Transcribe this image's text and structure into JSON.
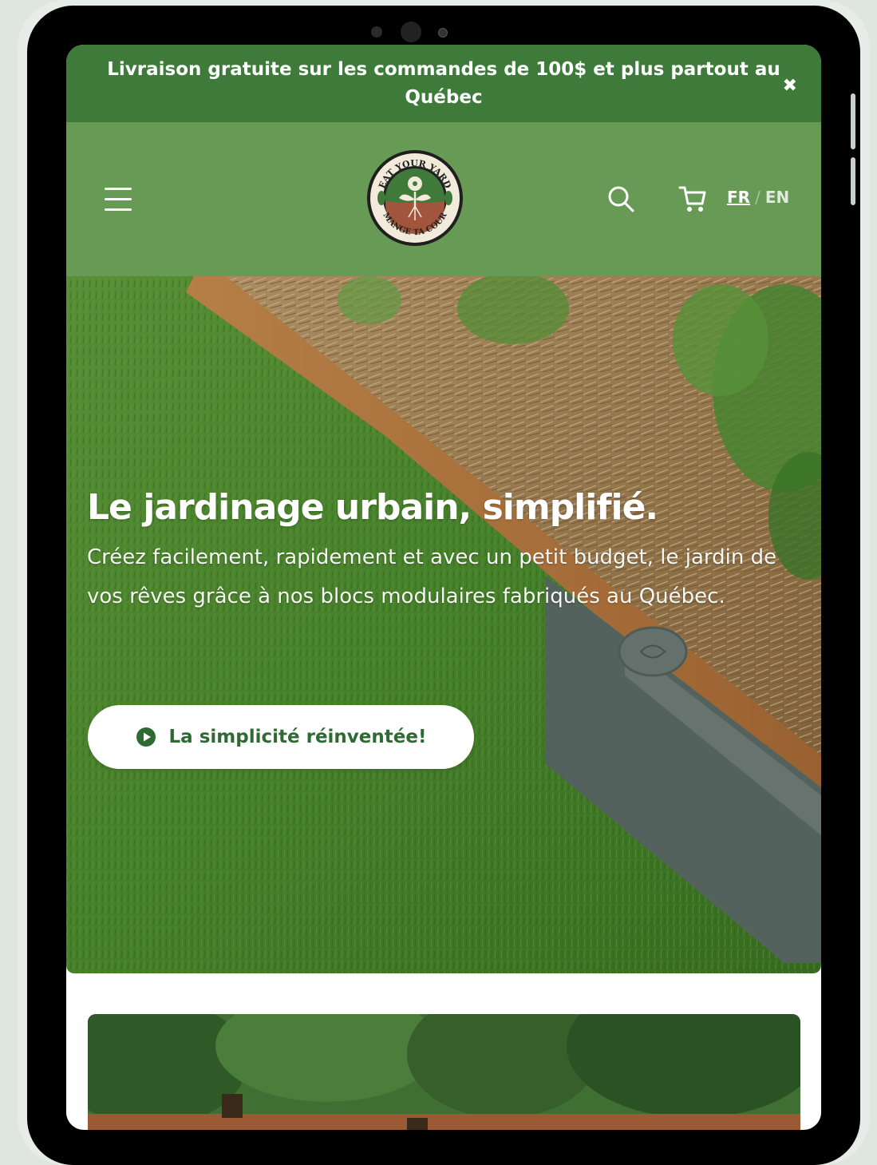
{
  "announcement": {
    "text": "Livraison gratuite sur les commandes de 100$ et plus partout au Québec",
    "close_icon": "close-icon"
  },
  "header": {
    "menu_icon": "hamburger-menu-icon",
    "logo": {
      "top_text": "EAT YOUR YARD",
      "bottom_text": "MANGE TA COUR"
    },
    "search_icon": "search-icon",
    "cart_icon": "cart-icon",
    "lang": {
      "fr": "FR",
      "separator": "/",
      "en": "EN"
    }
  },
  "hero": {
    "title": "Le jardinage urbain, simplifié.",
    "description": "Créez facilement, rapidement et avec un petit budget, le jardin de vos rêves grâce à nos blocs modulaires fabriqués au Québec.",
    "cta_label": "La simplicité réinventée!",
    "cta_icon": "play-circle-icon"
  },
  "colors": {
    "announcement_bg": "#3e7b3a",
    "header_bg": "#669a55",
    "cta_text": "#2e6b33"
  }
}
